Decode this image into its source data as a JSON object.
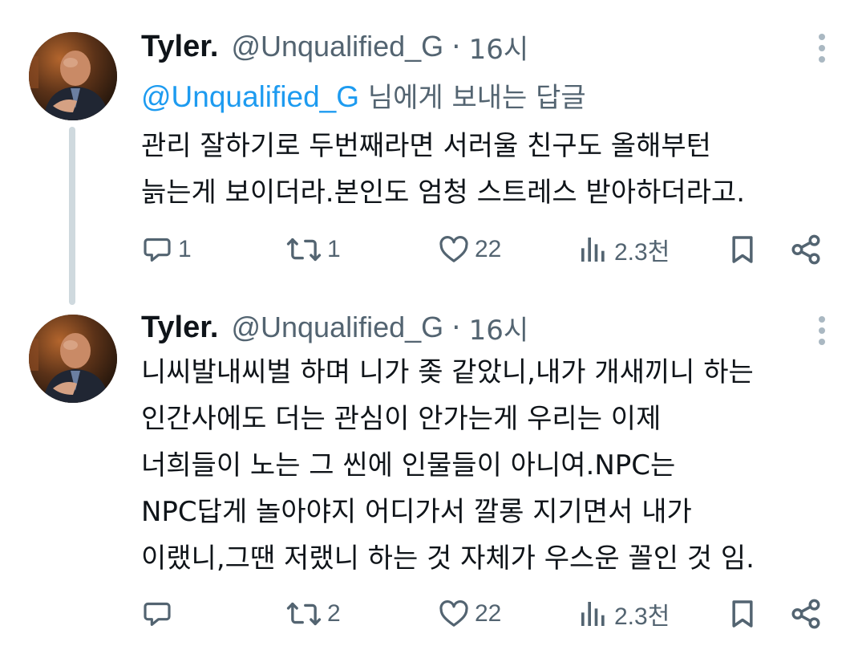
{
  "tweets": [
    {
      "name": "Tyler.",
      "handle": "@Unqualified_G",
      "dot": "·",
      "time": "16시",
      "reply_mention": "@Unqualified_G",
      "reply_suffix": " 님에게 보내는 답글",
      "lines": [
        "관리 잘하기로 두번째라면 서러울 친구도 올해부턴",
        "늙는게 보이더라.본인도 엄청 스트레스 받아하더라고."
      ],
      "replies": "1",
      "retweets": "1",
      "likes": "22",
      "views": "2.3천"
    },
    {
      "name": "Tyler.",
      "handle": "@Unqualified_G",
      "dot": "·",
      "time": "16시",
      "lines": [
        "니씨발내씨벌 하며 니가 좆 같았니,내가 개새끼니 하는",
        "인간사에도 더는 관심이 안가는게 우리는 이제",
        "너희들이 노는 그 씬에 인물들이 아니여.NPC는",
        "NPC답게 놀아야지 어디가서 깔롱 지기면서 내가",
        "이랬니,그땐 저랬니 하는 것 자체가 우스운 꼴인 것 임."
      ],
      "replies": "",
      "retweets": "2",
      "likes": "22",
      "views": "2.3천"
    }
  ],
  "icons": {
    "reply": "reply-icon",
    "retweet": "retweet-icon",
    "like": "heart-icon",
    "views": "views-icon",
    "bookmark": "bookmark-icon",
    "share": "share-icon",
    "more": "more-icon"
  },
  "colors": {
    "text": "#0f1419",
    "secondary": "#536471",
    "link": "#1d9bf0",
    "thread_line": "#cfd9de"
  }
}
